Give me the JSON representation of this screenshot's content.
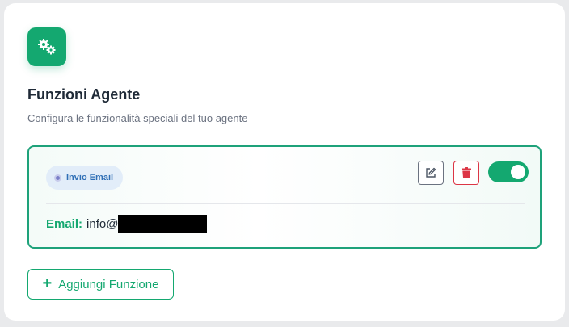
{
  "header": {
    "icon": "gears-icon",
    "title": "Funzioni Agente",
    "subtitle": "Configura le funzionalità speciali del tuo agente"
  },
  "function_card": {
    "tag_label": "Invio Email",
    "actions": {
      "edit_icon": "edit-icon",
      "delete_icon": "trash-icon",
      "toggle_enabled": true
    },
    "email_label": "Email:",
    "email_value": "info@"
  },
  "add_button": {
    "icon": "+",
    "label": "Aggiungi Funzione"
  },
  "colors": {
    "accent": "#14a870",
    "danger": "#dc3545",
    "tag_text": "#2f6fb6"
  }
}
